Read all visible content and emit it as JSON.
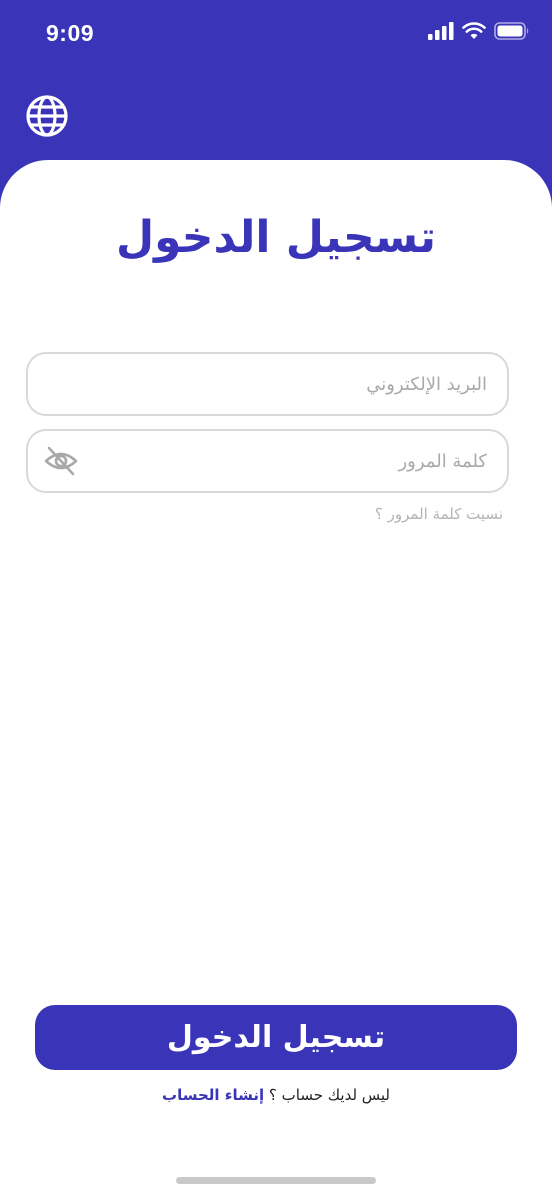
{
  "status_bar": {
    "time": "9:09",
    "icons": [
      "signal-icon",
      "wifi-icon",
      "battery-icon"
    ]
  },
  "header": {
    "language_icon": "globe-icon"
  },
  "login": {
    "title": "تسجيل الدخول",
    "email_placeholder": "البريد الإلكتروني",
    "email_value": "",
    "password_placeholder": "كلمة المرور",
    "password_value": "",
    "password_toggle_icon": "eye-off-icon",
    "forgot_password": "نسيت كلمة المرور ؟",
    "submit_label": "تسجيل الدخول",
    "no_account_text": "ليس لديك حساب ؟",
    "create_account_label": "إنشاء الحساب"
  },
  "colors": {
    "primary": "#3934b8",
    "placeholder": "#a9a9a9",
    "border": "#d9d9d9"
  }
}
